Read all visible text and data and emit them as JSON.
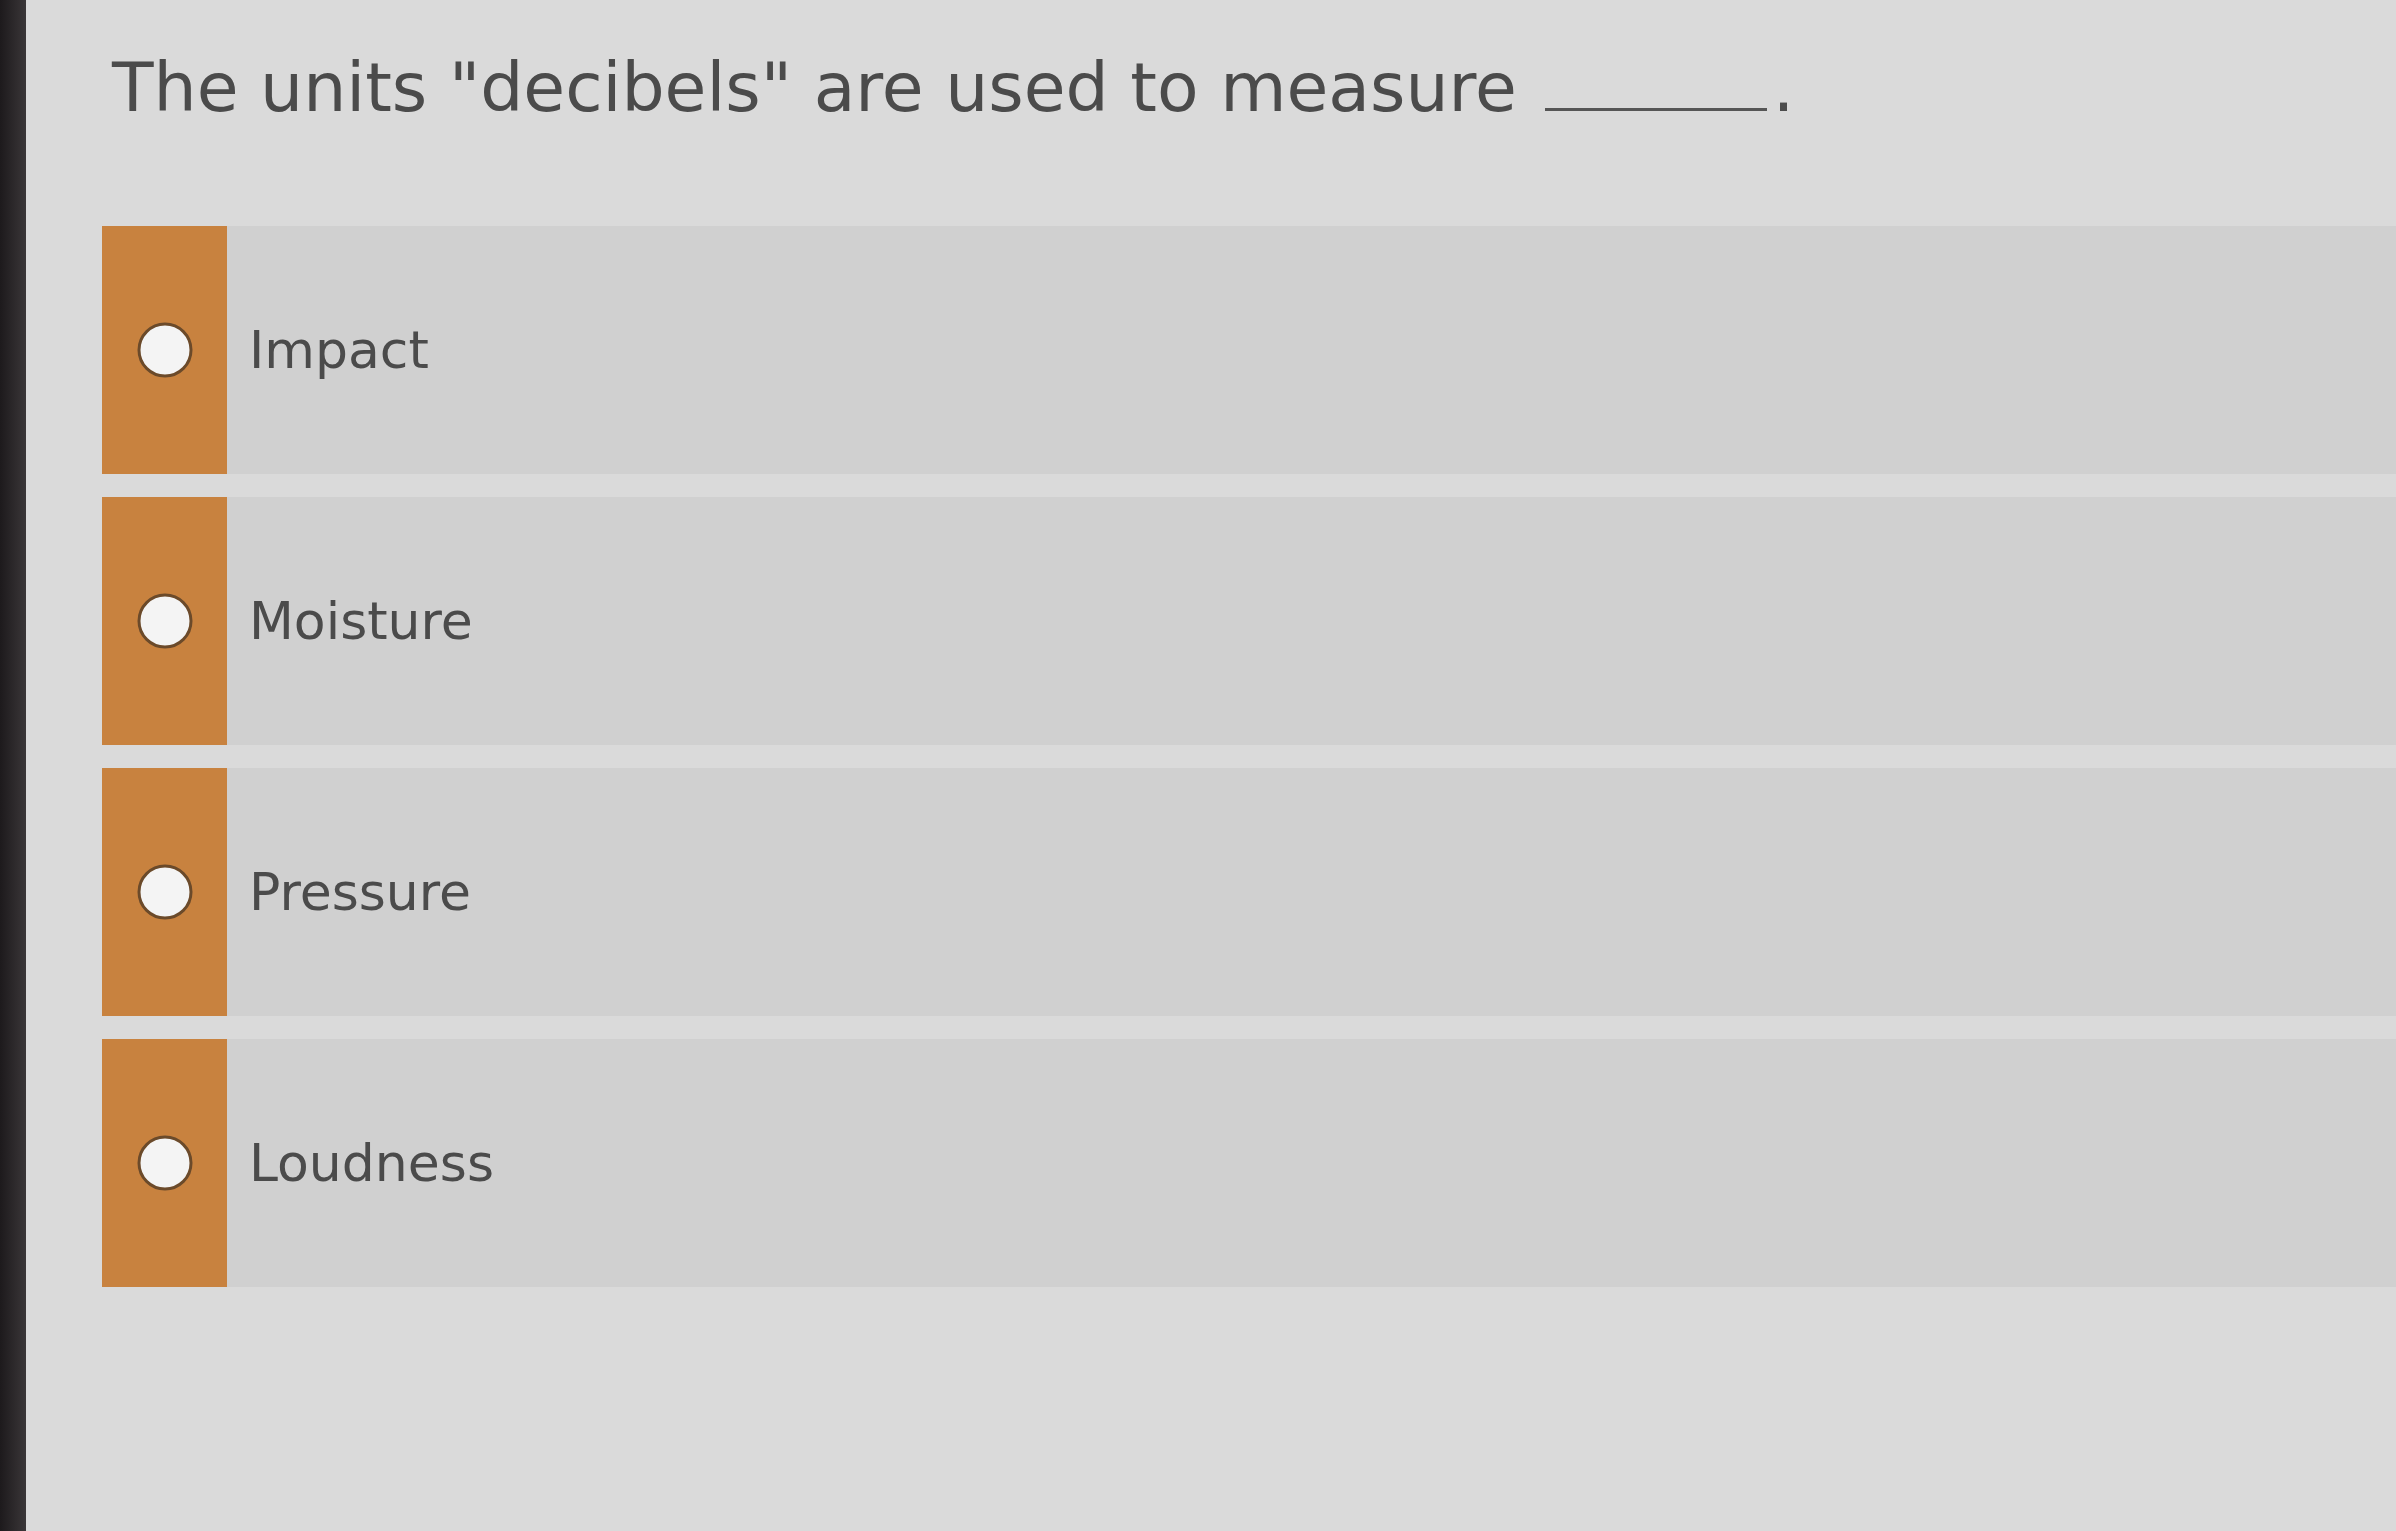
{
  "question": {
    "text": "The units \"decibels\" are used to measure",
    "end": "."
  },
  "options": [
    {
      "label": "Impact",
      "selected": false
    },
    {
      "label": "Moisture",
      "selected": false
    },
    {
      "label": "Pressure",
      "selected": false
    },
    {
      "label": "Loudness",
      "selected": false
    }
  ]
}
